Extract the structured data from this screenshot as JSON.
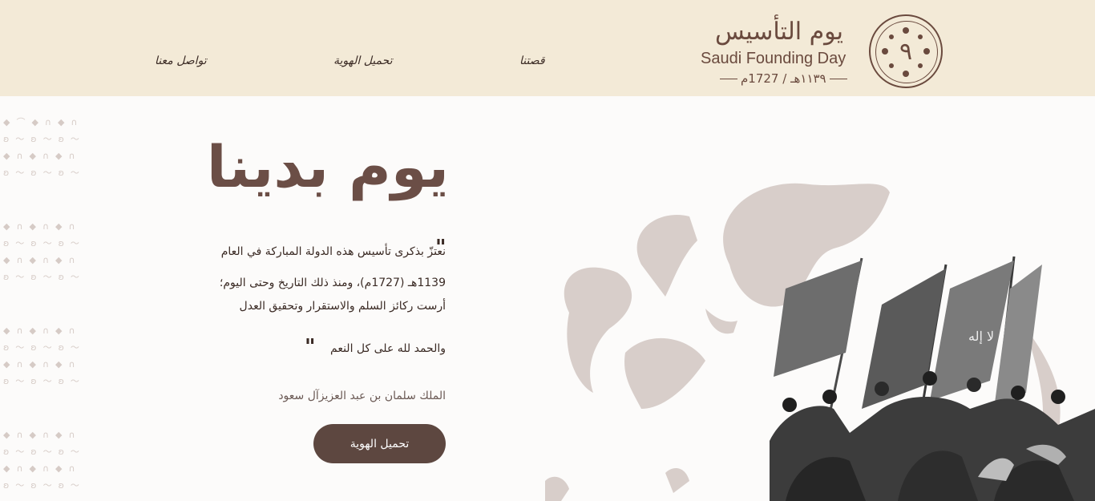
{
  "header": {
    "nav": {
      "story": "قصتنا",
      "download_identity": "تحميل الهوية",
      "contact": "تواصل معنا"
    },
    "logo": {
      "arabic": "يوم التأسيس",
      "english": "Saudi Founding Day",
      "date": "١١٣٩هـ / 1727م"
    }
  },
  "hero": {
    "title": "يوم بدينا",
    "quote_lines": [
      "نعتزّ بذكرى تأسيس هذه الدولة المباركة في العام",
      "1139هـ (1727م)، ومنذ ذلك التاريخ وحتى اليوم؛",
      "أرست ركائز السلم والاستقرار وتحقيق العدل",
      "والحمد لله على كل النعم"
    ],
    "author": "الملك سلمان بن عبد العزيزآل سعود",
    "cta_label": "تحميل الهوية"
  },
  "colors": {
    "header_bg": "#f3ead7",
    "brand_brown": "#5d4740",
    "title_brown": "#6b4e46",
    "page_bg": "#fcfbfa",
    "pattern": "#d6cbc6"
  }
}
